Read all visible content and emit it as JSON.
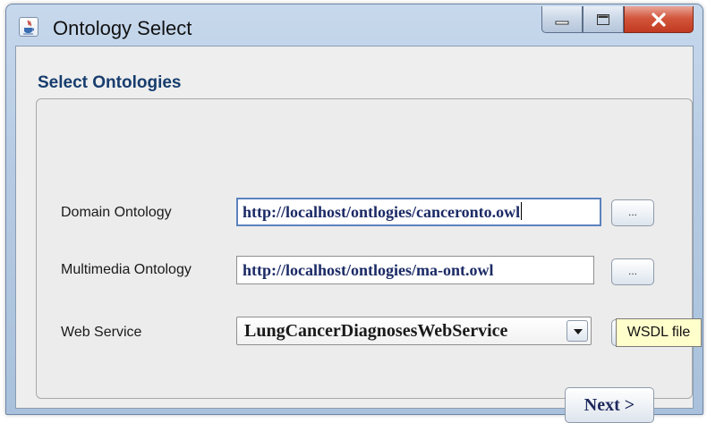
{
  "window": {
    "title": "Ontology Select"
  },
  "section": {
    "title": "Select Ontologies"
  },
  "form": {
    "domain": {
      "label": "Domain Ontology",
      "value": "http://localhost/ontlogies/canceronto.owl",
      "browse_label": "..."
    },
    "multimedia": {
      "label": "Multimedia Ontology",
      "value": "http://localhost/ontlogies/ma-ont.owl",
      "browse_label": "..."
    },
    "webservice": {
      "label": "Web Service",
      "selected": "LungCancerDiagnosesWebService",
      "browse_label": "..."
    }
  },
  "actions": {
    "next_label": "Next >"
  },
  "tooltip": {
    "text": "WSDL file"
  },
  "colors": {
    "section_title": "#173d6e",
    "field_text": "#1b2a66",
    "tooltip_bg": "#ffffcc",
    "close_button": "#c0391f"
  }
}
